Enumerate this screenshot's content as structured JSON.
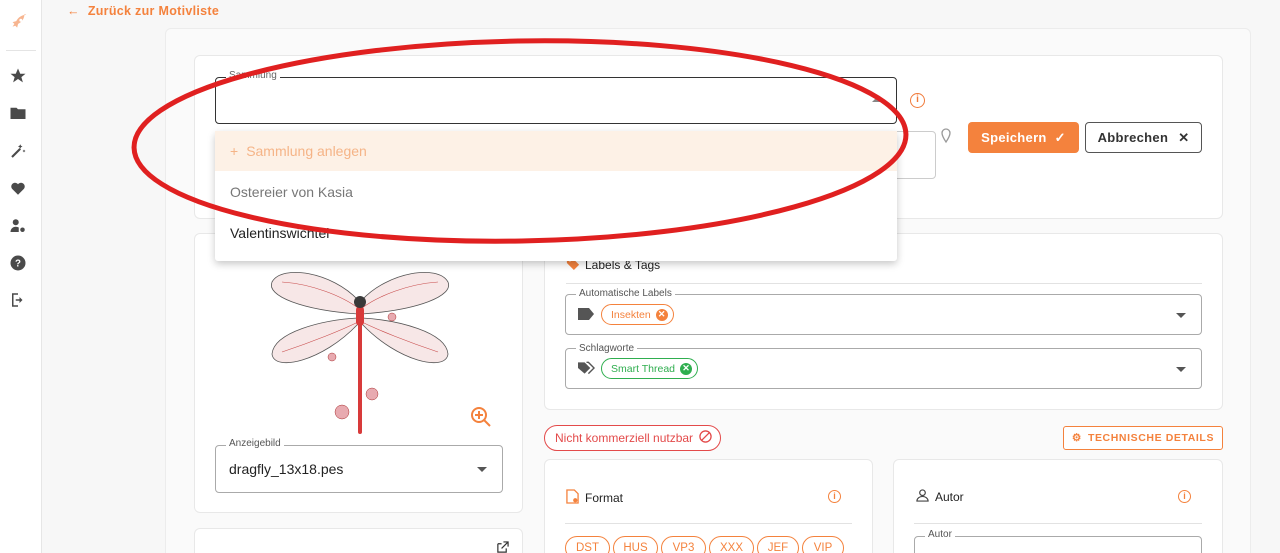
{
  "nav": {
    "back_label": "Zurück zur Motivliste",
    "items": [
      "logo-icon",
      "star-icon",
      "folder-icon",
      "magic-wand-icon",
      "heart-icon",
      "user-settings-icon",
      "help-icon",
      "logout-icon"
    ]
  },
  "collection": {
    "label": "Sammlung",
    "value": "",
    "options": {
      "create": "Sammlung anlegen",
      "item1": "Ostereier von Kasia",
      "item2": "Valentinswichtel"
    }
  },
  "buttons": {
    "save": "Speichern",
    "cancel": "Abbrechen",
    "technical": "TECHNISCHE DETAILS"
  },
  "display_image": {
    "label": "Anzeigebild",
    "value": "dragfly_13x18.pes"
  },
  "labels_card": {
    "title": "Labels & Tags",
    "auto_labels": {
      "label": "Automatische Labels",
      "chips": [
        "Insekten"
      ]
    },
    "keywords": {
      "label": "Schlagworte",
      "chips": [
        "Smart Thread"
      ]
    }
  },
  "commercial": "Nicht kommerziell nutzbar",
  "format": {
    "title": "Format",
    "chips": [
      "DST",
      "HUS",
      "VP3",
      "XXX",
      "JEF",
      "VIP"
    ]
  },
  "autor": {
    "title": "Autor",
    "field_label": "Autor"
  },
  "colors": {
    "accent": "#f4823d",
    "annotation": "#e02020",
    "green": "#2fae4f",
    "danger": "#e34a4a"
  }
}
